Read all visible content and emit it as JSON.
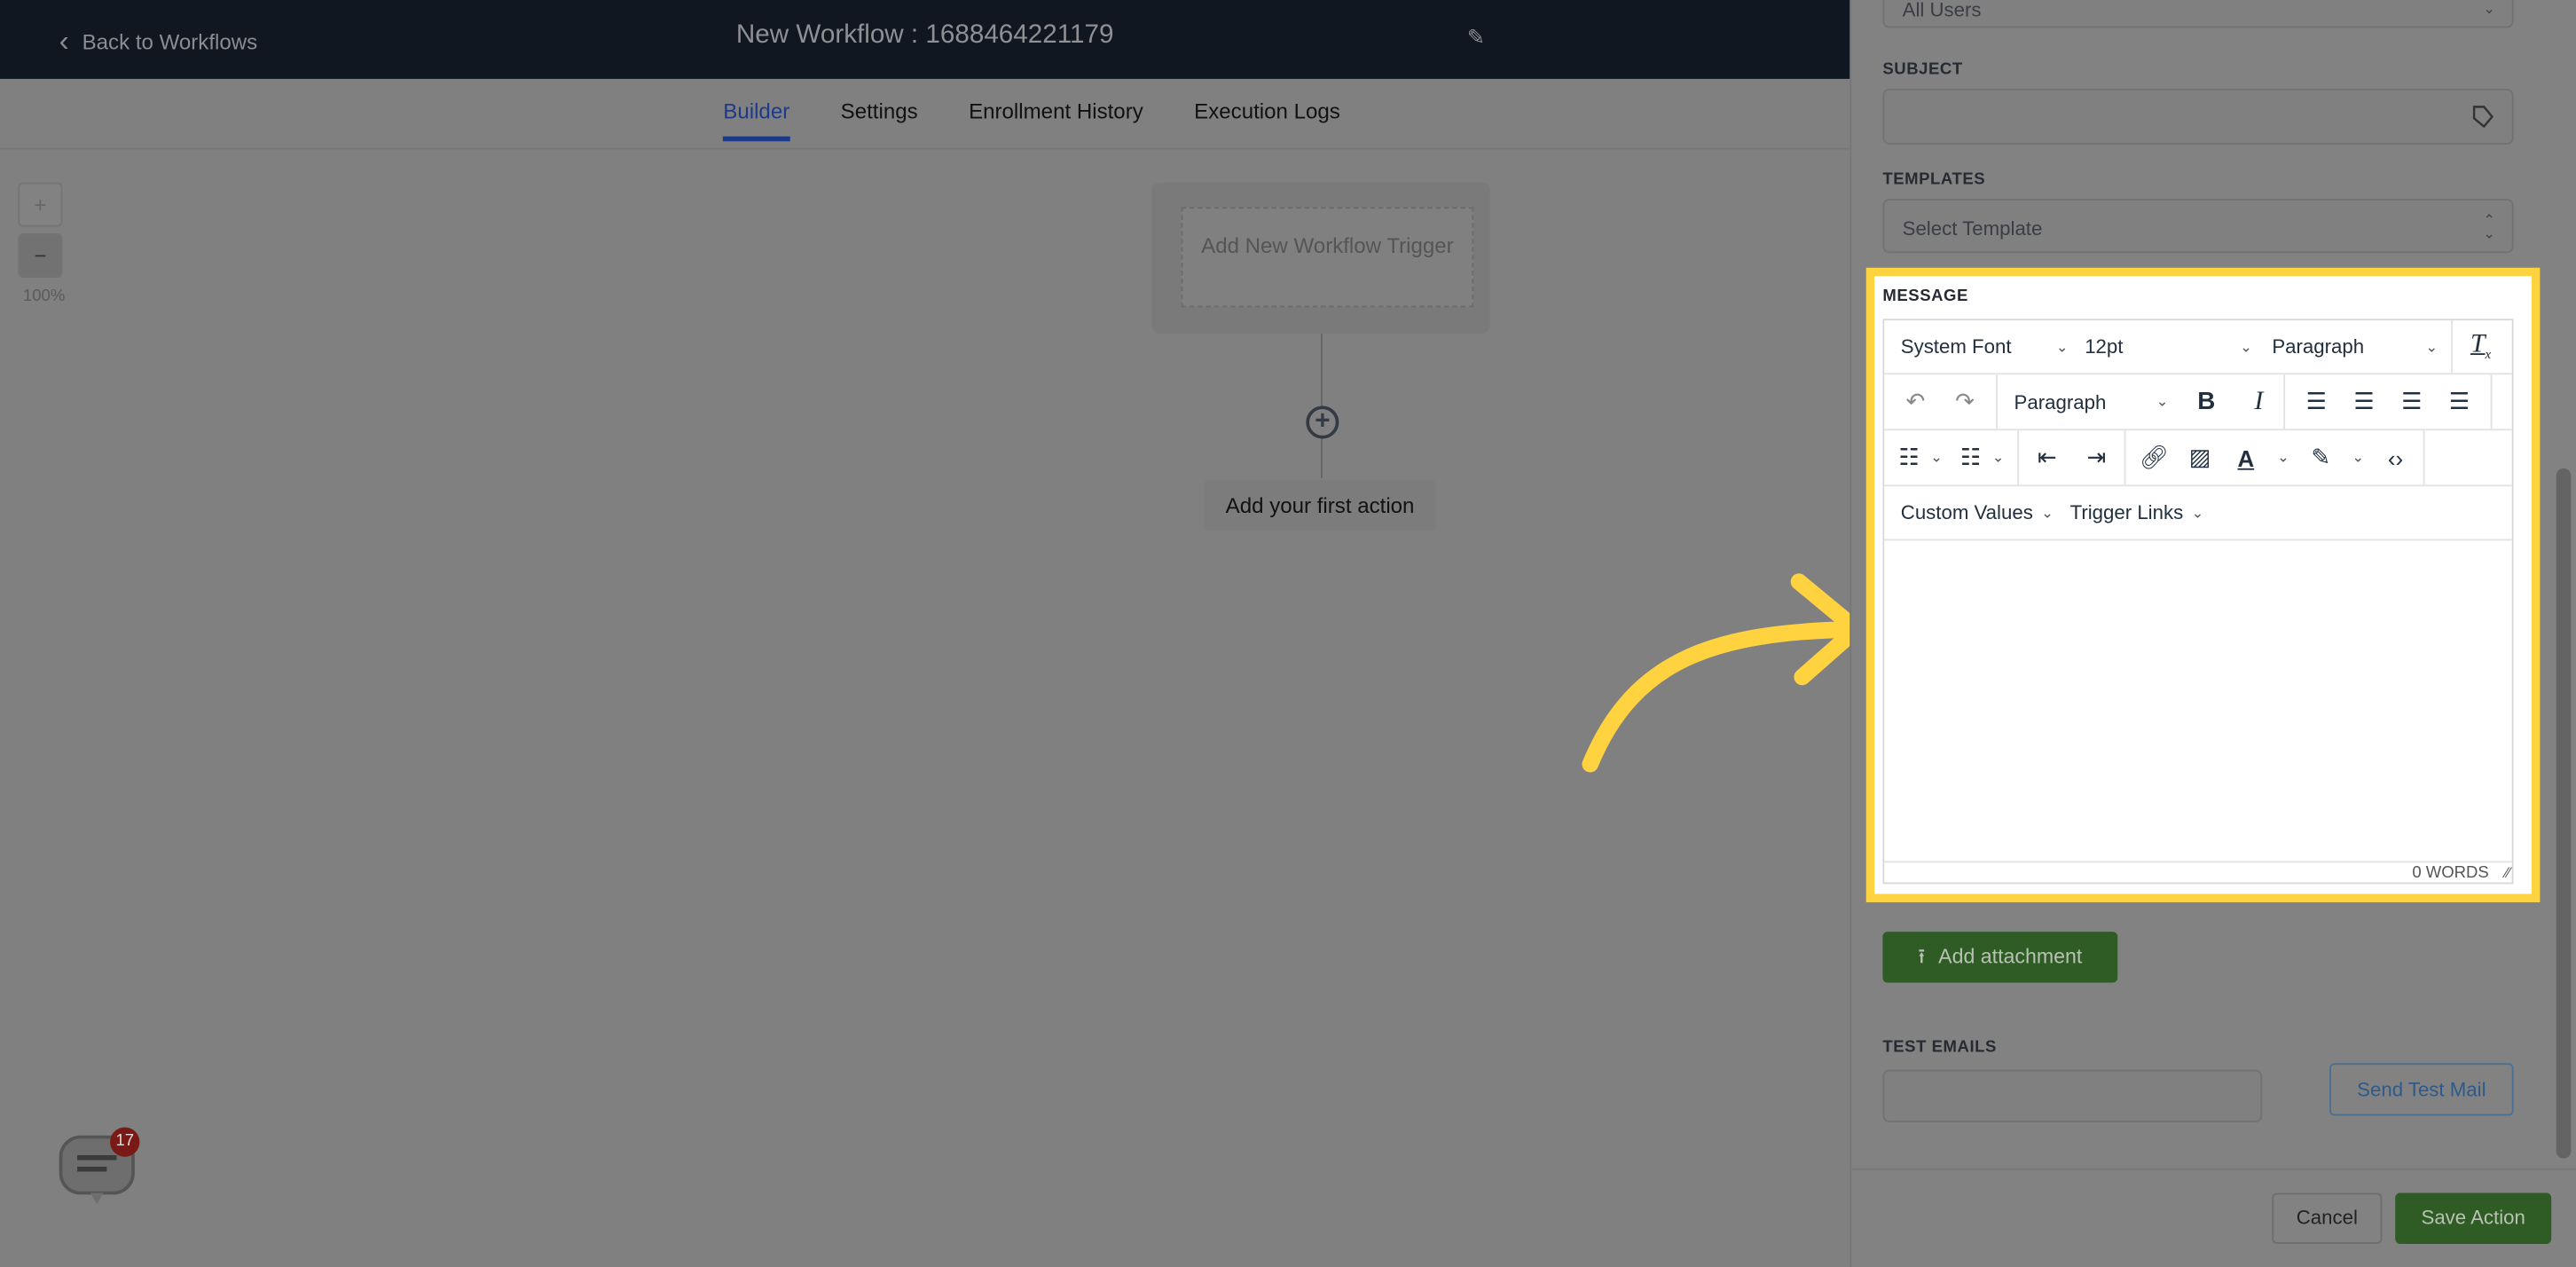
{
  "header": {
    "back_label": "Back to Workflows",
    "title": "New Workflow : 1688464221179"
  },
  "tabs": [
    {
      "label": "Builder",
      "active": true
    },
    {
      "label": "Settings"
    },
    {
      "label": "Enrollment History"
    },
    {
      "label": "Execution Logs"
    }
  ],
  "canvas": {
    "zoom_in": "+",
    "zoom_out": "−",
    "zoom_level": "100%",
    "trigger_label": "Add New Workflow Trigger",
    "first_action_label": "Add your first action",
    "chat_badge": "17"
  },
  "panel": {
    "from_select_value": "All Users",
    "subject_label": "SUBJECT",
    "subject_value": "",
    "templates_label": "TEMPLATES",
    "templates_placeholder": "Select Template",
    "message_label": "MESSAGE",
    "toolbar": {
      "font": "System Font",
      "size": "12pt",
      "format": "Paragraph",
      "block": "Paragraph",
      "custom_values": "Custom Values",
      "trigger_links": "Trigger Links"
    },
    "word_count": "0 WORDS",
    "add_attachment": "Add attachment",
    "test_emails_label": "TEST EMAILS",
    "test_emails_value": "",
    "send_test_mail": "Send Test Mail",
    "cancel": "Cancel",
    "save": "Save Action"
  },
  "colors": {
    "highlight": "#ffd23f",
    "accent_green": "#2e5c24",
    "tab_active": "#1d3a8a"
  }
}
